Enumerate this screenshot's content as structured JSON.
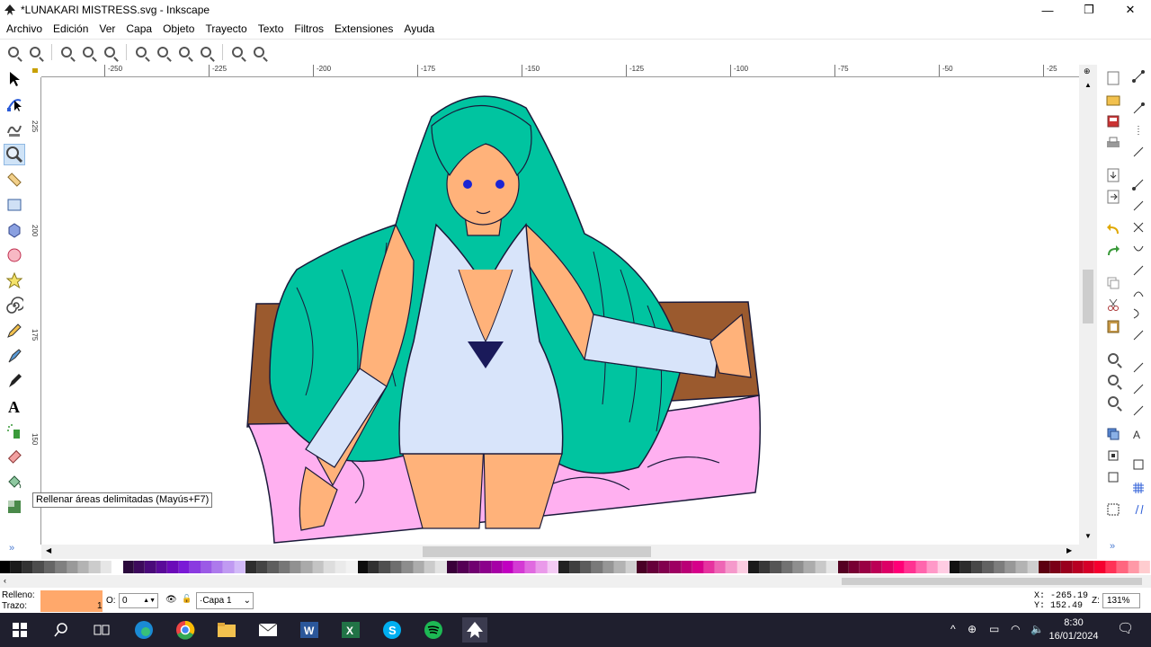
{
  "window": {
    "title": "*LUNAKARI MISTRESS.svg - Inkscape",
    "minimize": "—",
    "restore": "❐",
    "close": "✕"
  },
  "menu": [
    "Archivo",
    "Edición",
    "Ver",
    "Capa",
    "Objeto",
    "Trayecto",
    "Texto",
    "Filtros",
    "Extensiones",
    "Ayuda"
  ],
  "ruler": {
    "h_labels": [
      "-250",
      "-225",
      "-200",
      "-175",
      "-150",
      "-125",
      "-100",
      "-75",
      "-50",
      "-25"
    ],
    "v_labels": [
      "225",
      "200",
      "175",
      "150"
    ]
  },
  "tooltip": "Rellenar áreas delimitadas (Mayús+F7)",
  "statusbar": {
    "fill_label": "Relleno:",
    "stroke_label": "Trazo:",
    "stroke_width": "1",
    "opacity_label": "O:",
    "opacity_value": "0",
    "layer": "·Capa 1",
    "x_label": "X:",
    "x_value": "-265.19",
    "y_label": "Y:",
    "y_value": "152.49",
    "zoom_label": "Z:",
    "zoom_value": "131%",
    "fill_color": "#ffa86b"
  },
  "taskbar": {
    "time": "8:30",
    "date": "16/01/2024"
  },
  "palette": [
    "#000000",
    "#1a1a1a",
    "#333333",
    "#4d4d4d",
    "#666666",
    "#808080",
    "#999999",
    "#b3b3b3",
    "#cccccc",
    "#e6e6e6",
    "#ffffff",
    "#2b0a3d",
    "#3d0a5c",
    "#4a0a7a",
    "#5a0a99",
    "#6b0ab8",
    "#7a1ad6",
    "#8a3ae0",
    "#9b5ae6",
    "#ad7aec",
    "#c09af2",
    "#d2baf8",
    "#2e2e2e",
    "#444444",
    "#5e5e5e",
    "#777777",
    "#919191",
    "#aaaaaa",
    "#c4c4c4",
    "#dddddd",
    "#eaeaea",
    "#f2f2f2",
    "#0d0d0d",
    "#303030",
    "#4f4f4f",
    "#6e6e6e",
    "#8d8d8d",
    "#acacac",
    "#cbcbcb",
    "#e3e3e3",
    "#3a003a",
    "#550055",
    "#700070",
    "#8b008b",
    "#a600a6",
    "#c100c1",
    "#d43ad4",
    "#e06ae0",
    "#ea9aea",
    "#f4caf4",
    "#222222",
    "#3f3f3f",
    "#5c5c5c",
    "#797979",
    "#969696",
    "#b3b3b3",
    "#d0d0d0",
    "#4a0026",
    "#66003a",
    "#82004e",
    "#9e0062",
    "#ba0076",
    "#d6008a",
    "#e6339f",
    "#ee66b5",
    "#f599cb",
    "#fbcce1",
    "#1b1b1b",
    "#383838",
    "#555555",
    "#727272",
    "#8f8f8f",
    "#acacac",
    "#c9c9c9",
    "#e6e6e6",
    "#550022",
    "#770033",
    "#990044",
    "#bb0055",
    "#dd0066",
    "#ff0077",
    "#ff3392",
    "#ff66ad",
    "#ff99c8",
    "#ffcce3",
    "#111111",
    "#2c2c2c",
    "#474747",
    "#626262",
    "#7d7d7d",
    "#989898",
    "#b3b3b3",
    "#cecece",
    "#5c0011",
    "#7a0017",
    "#99001d",
    "#b80023",
    "#d60029",
    "#f5002f",
    "#ff3357",
    "#ff667f",
    "#ff99a7",
    "#ffcccf"
  ],
  "artwork": {
    "hair": "#00c4a0",
    "skin": "#ffb27a",
    "dress": "#d8e4fa",
    "bed_frame": "#9b5a2e",
    "blanket": "#ffb0f0",
    "outline": "#1a1a3a",
    "eye": "#1a24d4"
  }
}
